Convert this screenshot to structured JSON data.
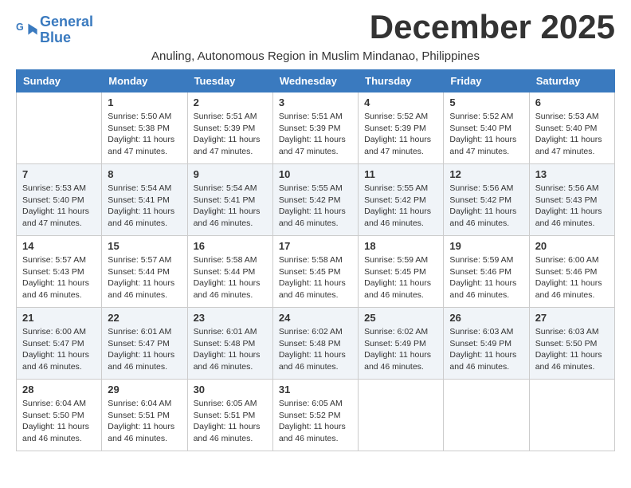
{
  "logo": {
    "line1": "General",
    "line2": "Blue"
  },
  "title": "December 2025",
  "subtitle": "Anuling, Autonomous Region in Muslim Mindanao, Philippines",
  "days_of_week": [
    "Sunday",
    "Monday",
    "Tuesday",
    "Wednesday",
    "Thursday",
    "Friday",
    "Saturday"
  ],
  "weeks": [
    [
      {
        "day": "",
        "info": ""
      },
      {
        "day": "1",
        "info": "Sunrise: 5:50 AM\nSunset: 5:38 PM\nDaylight: 11 hours\nand 47 minutes."
      },
      {
        "day": "2",
        "info": "Sunrise: 5:51 AM\nSunset: 5:39 PM\nDaylight: 11 hours\nand 47 minutes."
      },
      {
        "day": "3",
        "info": "Sunrise: 5:51 AM\nSunset: 5:39 PM\nDaylight: 11 hours\nand 47 minutes."
      },
      {
        "day": "4",
        "info": "Sunrise: 5:52 AM\nSunset: 5:39 PM\nDaylight: 11 hours\nand 47 minutes."
      },
      {
        "day": "5",
        "info": "Sunrise: 5:52 AM\nSunset: 5:40 PM\nDaylight: 11 hours\nand 47 minutes."
      },
      {
        "day": "6",
        "info": "Sunrise: 5:53 AM\nSunset: 5:40 PM\nDaylight: 11 hours\nand 47 minutes."
      }
    ],
    [
      {
        "day": "7",
        "info": "Sunrise: 5:53 AM\nSunset: 5:40 PM\nDaylight: 11 hours\nand 47 minutes."
      },
      {
        "day": "8",
        "info": "Sunrise: 5:54 AM\nSunset: 5:41 PM\nDaylight: 11 hours\nand 46 minutes."
      },
      {
        "day": "9",
        "info": "Sunrise: 5:54 AM\nSunset: 5:41 PM\nDaylight: 11 hours\nand 46 minutes."
      },
      {
        "day": "10",
        "info": "Sunrise: 5:55 AM\nSunset: 5:42 PM\nDaylight: 11 hours\nand 46 minutes."
      },
      {
        "day": "11",
        "info": "Sunrise: 5:55 AM\nSunset: 5:42 PM\nDaylight: 11 hours\nand 46 minutes."
      },
      {
        "day": "12",
        "info": "Sunrise: 5:56 AM\nSunset: 5:42 PM\nDaylight: 11 hours\nand 46 minutes."
      },
      {
        "day": "13",
        "info": "Sunrise: 5:56 AM\nSunset: 5:43 PM\nDaylight: 11 hours\nand 46 minutes."
      }
    ],
    [
      {
        "day": "14",
        "info": "Sunrise: 5:57 AM\nSunset: 5:43 PM\nDaylight: 11 hours\nand 46 minutes."
      },
      {
        "day": "15",
        "info": "Sunrise: 5:57 AM\nSunset: 5:44 PM\nDaylight: 11 hours\nand 46 minutes."
      },
      {
        "day": "16",
        "info": "Sunrise: 5:58 AM\nSunset: 5:44 PM\nDaylight: 11 hours\nand 46 minutes."
      },
      {
        "day": "17",
        "info": "Sunrise: 5:58 AM\nSunset: 5:45 PM\nDaylight: 11 hours\nand 46 minutes."
      },
      {
        "day": "18",
        "info": "Sunrise: 5:59 AM\nSunset: 5:45 PM\nDaylight: 11 hours\nand 46 minutes."
      },
      {
        "day": "19",
        "info": "Sunrise: 5:59 AM\nSunset: 5:46 PM\nDaylight: 11 hours\nand 46 minutes."
      },
      {
        "day": "20",
        "info": "Sunrise: 6:00 AM\nSunset: 5:46 PM\nDaylight: 11 hours\nand 46 minutes."
      }
    ],
    [
      {
        "day": "21",
        "info": "Sunrise: 6:00 AM\nSunset: 5:47 PM\nDaylight: 11 hours\nand 46 minutes."
      },
      {
        "day": "22",
        "info": "Sunrise: 6:01 AM\nSunset: 5:47 PM\nDaylight: 11 hours\nand 46 minutes."
      },
      {
        "day": "23",
        "info": "Sunrise: 6:01 AM\nSunset: 5:48 PM\nDaylight: 11 hours\nand 46 minutes."
      },
      {
        "day": "24",
        "info": "Sunrise: 6:02 AM\nSunset: 5:48 PM\nDaylight: 11 hours\nand 46 minutes."
      },
      {
        "day": "25",
        "info": "Sunrise: 6:02 AM\nSunset: 5:49 PM\nDaylight: 11 hours\nand 46 minutes."
      },
      {
        "day": "26",
        "info": "Sunrise: 6:03 AM\nSunset: 5:49 PM\nDaylight: 11 hours\nand 46 minutes."
      },
      {
        "day": "27",
        "info": "Sunrise: 6:03 AM\nSunset: 5:50 PM\nDaylight: 11 hours\nand 46 minutes."
      }
    ],
    [
      {
        "day": "28",
        "info": "Sunrise: 6:04 AM\nSunset: 5:50 PM\nDaylight: 11 hours\nand 46 minutes."
      },
      {
        "day": "29",
        "info": "Sunrise: 6:04 AM\nSunset: 5:51 PM\nDaylight: 11 hours\nand 46 minutes."
      },
      {
        "day": "30",
        "info": "Sunrise: 6:05 AM\nSunset: 5:51 PM\nDaylight: 11 hours\nand 46 minutes."
      },
      {
        "day": "31",
        "info": "Sunrise: 6:05 AM\nSunset: 5:52 PM\nDaylight: 11 hours\nand 46 minutes."
      },
      {
        "day": "",
        "info": ""
      },
      {
        "day": "",
        "info": ""
      },
      {
        "day": "",
        "info": ""
      }
    ]
  ]
}
